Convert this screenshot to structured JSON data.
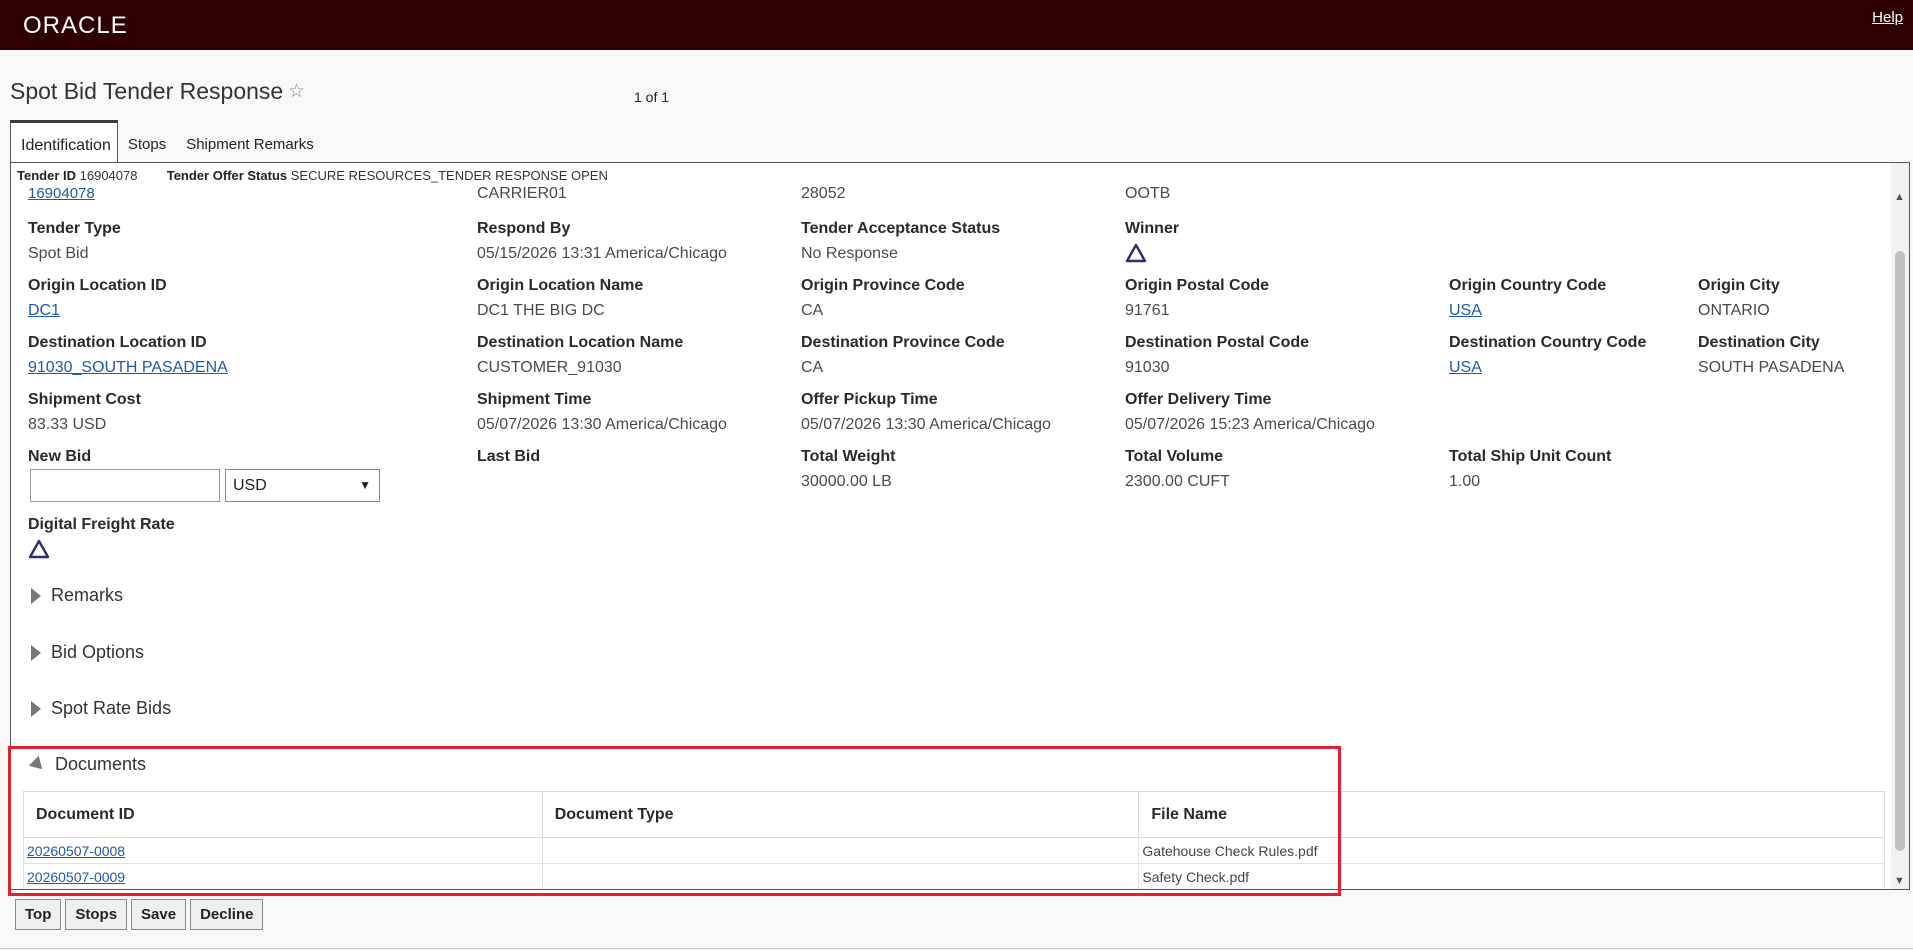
{
  "header": {
    "logo": "ORACLE",
    "help": "Help"
  },
  "page": {
    "title": "Spot Bid Tender Response",
    "pager": "1 of 1"
  },
  "tabs": [
    {
      "label": "Identification"
    },
    {
      "label": "Stops"
    },
    {
      "label": "Shipment Remarks"
    }
  ],
  "summary": {
    "tender_id_label": "Tender ID",
    "tender_id": "16904078",
    "status_label": "Tender Offer Status",
    "status": "SECURE RESOURCES_TENDER RESPONSE OPEN"
  },
  "row0": {
    "shipment": "16904078",
    "carrier": "CARRIER01",
    "num": "28052",
    "code": "OOTB"
  },
  "fields": {
    "tender_type": {
      "label": "Tender Type",
      "value": "Spot Bid"
    },
    "respond_by": {
      "label": "Respond By",
      "value": "05/15/2026 13:31 America/Chicago"
    },
    "acceptance": {
      "label": "Tender Acceptance Status",
      "value": "No Response"
    },
    "winner": {
      "label": "Winner"
    },
    "orig_loc_id": {
      "label": "Origin Location ID",
      "value": "DC1"
    },
    "orig_loc_name": {
      "label": "Origin Location Name",
      "value": "DC1 THE BIG DC"
    },
    "orig_prov": {
      "label": "Origin Province Code",
      "value": "CA"
    },
    "orig_postal": {
      "label": "Origin Postal Code",
      "value": "91761"
    },
    "orig_country": {
      "label": "Origin Country Code",
      "value": "USA"
    },
    "orig_city": {
      "label": "Origin City",
      "value": "ONTARIO"
    },
    "dest_loc_id": {
      "label": "Destination Location ID",
      "value": "91030_SOUTH PASADENA"
    },
    "dest_loc_name": {
      "label": "Destination Location Name",
      "value": "CUSTOMER_91030"
    },
    "dest_prov": {
      "label": "Destination Province Code",
      "value": "CA"
    },
    "dest_postal": {
      "label": "Destination Postal Code",
      "value": "91030"
    },
    "dest_country": {
      "label": "Destination Country Code",
      "value": "USA"
    },
    "dest_city": {
      "label": "Destination City",
      "value": "SOUTH PASADENA"
    },
    "ship_cost": {
      "label": "Shipment Cost",
      "value": "83.33 USD"
    },
    "ship_time": {
      "label": "Shipment Time",
      "value": "05/07/2026 13:30 America/Chicago"
    },
    "pickup": {
      "label": "Offer Pickup Time",
      "value": "05/07/2026 13:30 America/Chicago"
    },
    "delivery": {
      "label": "Offer Delivery Time",
      "value": "05/07/2026 15:23 America/Chicago"
    },
    "new_bid": {
      "label": "New Bid",
      "value": "",
      "currency": "USD"
    },
    "last_bid": {
      "label": "Last Bid"
    },
    "weight": {
      "label": "Total Weight",
      "value": "30000.00 LB"
    },
    "volume": {
      "label": "Total Volume",
      "value": "2300.00 CUFT"
    },
    "ship_units": {
      "label": "Total Ship Unit Count",
      "value": "1.00"
    },
    "dfr": {
      "label": "Digital Freight Rate"
    }
  },
  "sections": {
    "remarks": "Remarks",
    "bid_options": "Bid Options",
    "spot_rate_bids": "Spot Rate Bids",
    "documents": "Documents"
  },
  "documents": {
    "headers": [
      "Document ID",
      "Document Type",
      "File Name"
    ],
    "rows": [
      {
        "id": "20260507-0008",
        "type": "",
        "file": "Gatehouse Check Rules.pdf"
      },
      {
        "id": "20260507-0009",
        "type": "",
        "file": "Safety Check.pdf"
      }
    ]
  },
  "footer": {
    "top": "Top",
    "stops": "Stops",
    "save": "Save",
    "decline": "Decline"
  },
  "colors": {
    "topbar": "#2f0000",
    "link": "#1d5aa8",
    "highlight": "#e0212e",
    "icon": "#2a2f6b"
  }
}
